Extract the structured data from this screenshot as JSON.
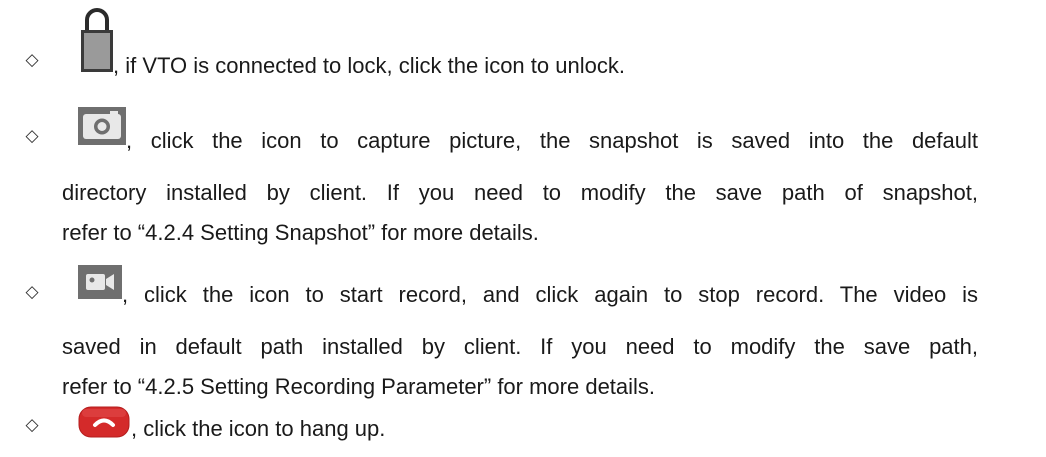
{
  "bullet_symbol": "◇",
  "items": [
    {
      "icon": "lock-icon",
      "lines": [
        ", if VTO is connected to lock, click the icon to unlock."
      ]
    },
    {
      "icon": "camera-icon",
      "lines": [
        ", click the icon to capture picture, the snapshot is saved into the default",
        "directory installed by client. If you need to modify the save path of snapshot,",
        "refer to “4.2.4 Setting Snapshot” for more details."
      ]
    },
    {
      "icon": "video-record-icon",
      "lines": [
        ", click the icon to start record, and click again to stop record. The video is",
        "saved in default path installed by client. If you need to modify the save path,",
        "refer to “4.2.5 Setting Recording Parameter” for more details."
      ]
    },
    {
      "icon": "hang-up-icon",
      "lines": [
        ", click the icon to hang up."
      ]
    }
  ]
}
